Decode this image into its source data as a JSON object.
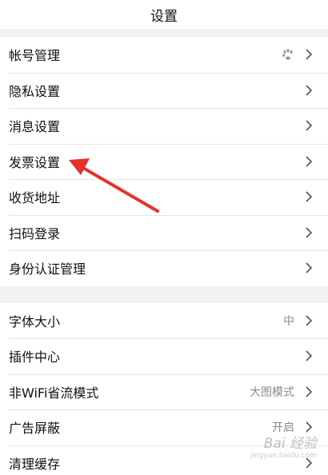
{
  "header": {
    "title": "设置"
  },
  "groups": [
    {
      "items": [
        {
          "label": "帐号管理",
          "icon": "paw-icon"
        },
        {
          "label": "隐私设置"
        },
        {
          "label": "消息设置"
        },
        {
          "label": "发票设置"
        },
        {
          "label": "收货地址"
        },
        {
          "label": "扫码登录"
        },
        {
          "label": "身份认证管理"
        }
      ]
    },
    {
      "items": [
        {
          "label": "字体大小",
          "value": "中"
        },
        {
          "label": "插件中心"
        },
        {
          "label": "非WiFi省流模式",
          "value": "大图模式"
        },
        {
          "label": "广告屏蔽",
          "value": "开启"
        },
        {
          "label": "清理缓存"
        }
      ]
    }
  ],
  "annotation": {
    "color": "#e8302a"
  },
  "watermark": {
    "text": "Bai 经验",
    "sub": "jingyan.baidu.com"
  }
}
